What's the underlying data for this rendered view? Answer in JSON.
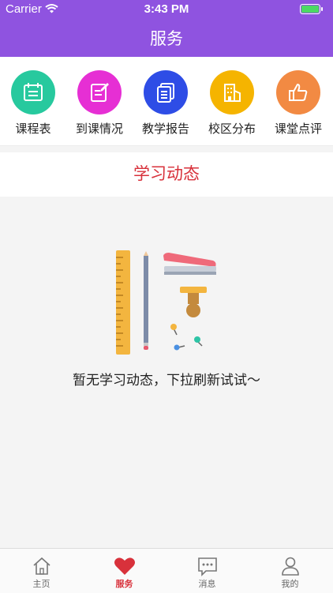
{
  "status_bar": {
    "carrier": "Carrier",
    "time": "3:43 PM"
  },
  "header": {
    "title": "服务"
  },
  "shortcuts": [
    {
      "label": "课程表",
      "color": "#27c99e",
      "icon": "calendar-icon"
    },
    {
      "label": "到课情况",
      "color": "#e62fd4",
      "icon": "edit-note-icon"
    },
    {
      "label": "教学报告",
      "color": "#2e4de6",
      "icon": "document-icon"
    },
    {
      "label": "校区分布",
      "color": "#f5b400",
      "icon": "building-icon"
    },
    {
      "label": "课堂点评",
      "color": "#f28a43",
      "icon": "thumbs-up-icon"
    }
  ],
  "section": {
    "title": "学习动态"
  },
  "empty_state": {
    "message": "暂无学习动态，下拉刷新试试～",
    "illustration": "stationery-illustration"
  },
  "tabbar": {
    "items": [
      {
        "label": "主页",
        "icon": "home-icon",
        "active": false
      },
      {
        "label": "服务",
        "icon": "heart-icon",
        "active": true
      },
      {
        "label": "消息",
        "icon": "message-icon",
        "active": false
      },
      {
        "label": "我的",
        "icon": "person-icon",
        "active": false
      }
    ]
  },
  "colors": {
    "header": "#8f53e0",
    "accent": "#d8313b"
  }
}
